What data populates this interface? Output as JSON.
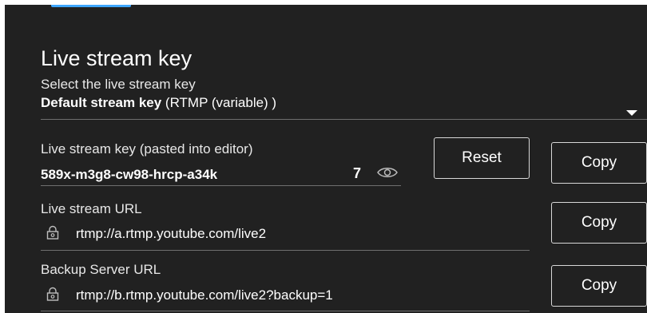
{
  "stream_key_section": {
    "title": "Live stream key",
    "select_label": "Select the live stream key",
    "selected_key_name": "Default stream key",
    "selected_key_type": "(RTMP (variable) )"
  },
  "stream_key_field": {
    "label": "Live stream key (pasted into editor)",
    "value": "589x-m3g8-cw98-hrcp-a34k",
    "count": "7",
    "reset_label": "Reset",
    "copy_label": "Copy"
  },
  "stream_url_field": {
    "label": "Live stream URL",
    "value": "rtmp://a.rtmp.youtube.com/live2",
    "copy_label": "Copy"
  },
  "backup_url_field": {
    "label": "Backup Server URL",
    "value": "rtmp://b.rtmp.youtube.com/live2?backup=1",
    "copy_label": "Copy"
  },
  "colors": {
    "background": "#212121",
    "accent": "#3ea6ff",
    "text": "#ffffff",
    "divider": "#6f6f6f"
  }
}
